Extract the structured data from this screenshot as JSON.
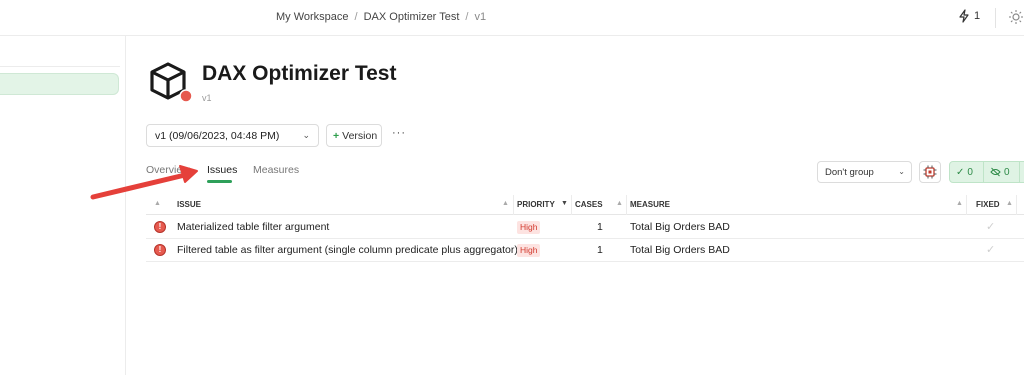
{
  "breadcrumb": {
    "workspace": "My Workspace",
    "model": "DAX Optimizer Test",
    "version": "v1",
    "separator": "/"
  },
  "topbar": {
    "credits_count": "1",
    "credits_icon": "bolt-icon",
    "theme_icon": "sun-icon"
  },
  "header": {
    "title": "DAX Optimizer Test",
    "version": "v1",
    "icon": "model-cube-icon",
    "status_color": "#e65a4f"
  },
  "toolbar": {
    "version_select_value": "v1 (09/06/2023, 04:48 PM)",
    "version_button_label": "Version",
    "more_label": "···"
  },
  "tabs": [
    {
      "label": "Overview",
      "active": false
    },
    {
      "label": "Issues",
      "active": true
    },
    {
      "label": "Measures",
      "active": false
    }
  ],
  "grouping": {
    "selected": "Don't group"
  },
  "counters": {
    "passed": "0",
    "hidden": "0"
  },
  "table": {
    "columns": {
      "issue": "ISSUE",
      "priority": "PRIORITY",
      "cases": "CASES",
      "measure": "MEASURE",
      "fixed": "FIXED"
    },
    "rows": [
      {
        "issue": "Materialized table filter argument",
        "priority": "High",
        "cases": "1",
        "measure": "Total Big Orders BAD",
        "fixed": false
      },
      {
        "issue": "Filtered table as filter argument (single column predicate plus aggregator)",
        "priority": "High",
        "cases": "1",
        "measure": "Total Big Orders BAD",
        "fixed": false
      }
    ]
  },
  "colors": {
    "accent_green": "#2ea05a",
    "priority_high_text": "#d2392d",
    "priority_high_bg": "#fde3e1",
    "annotation_arrow": "#e5403a"
  }
}
